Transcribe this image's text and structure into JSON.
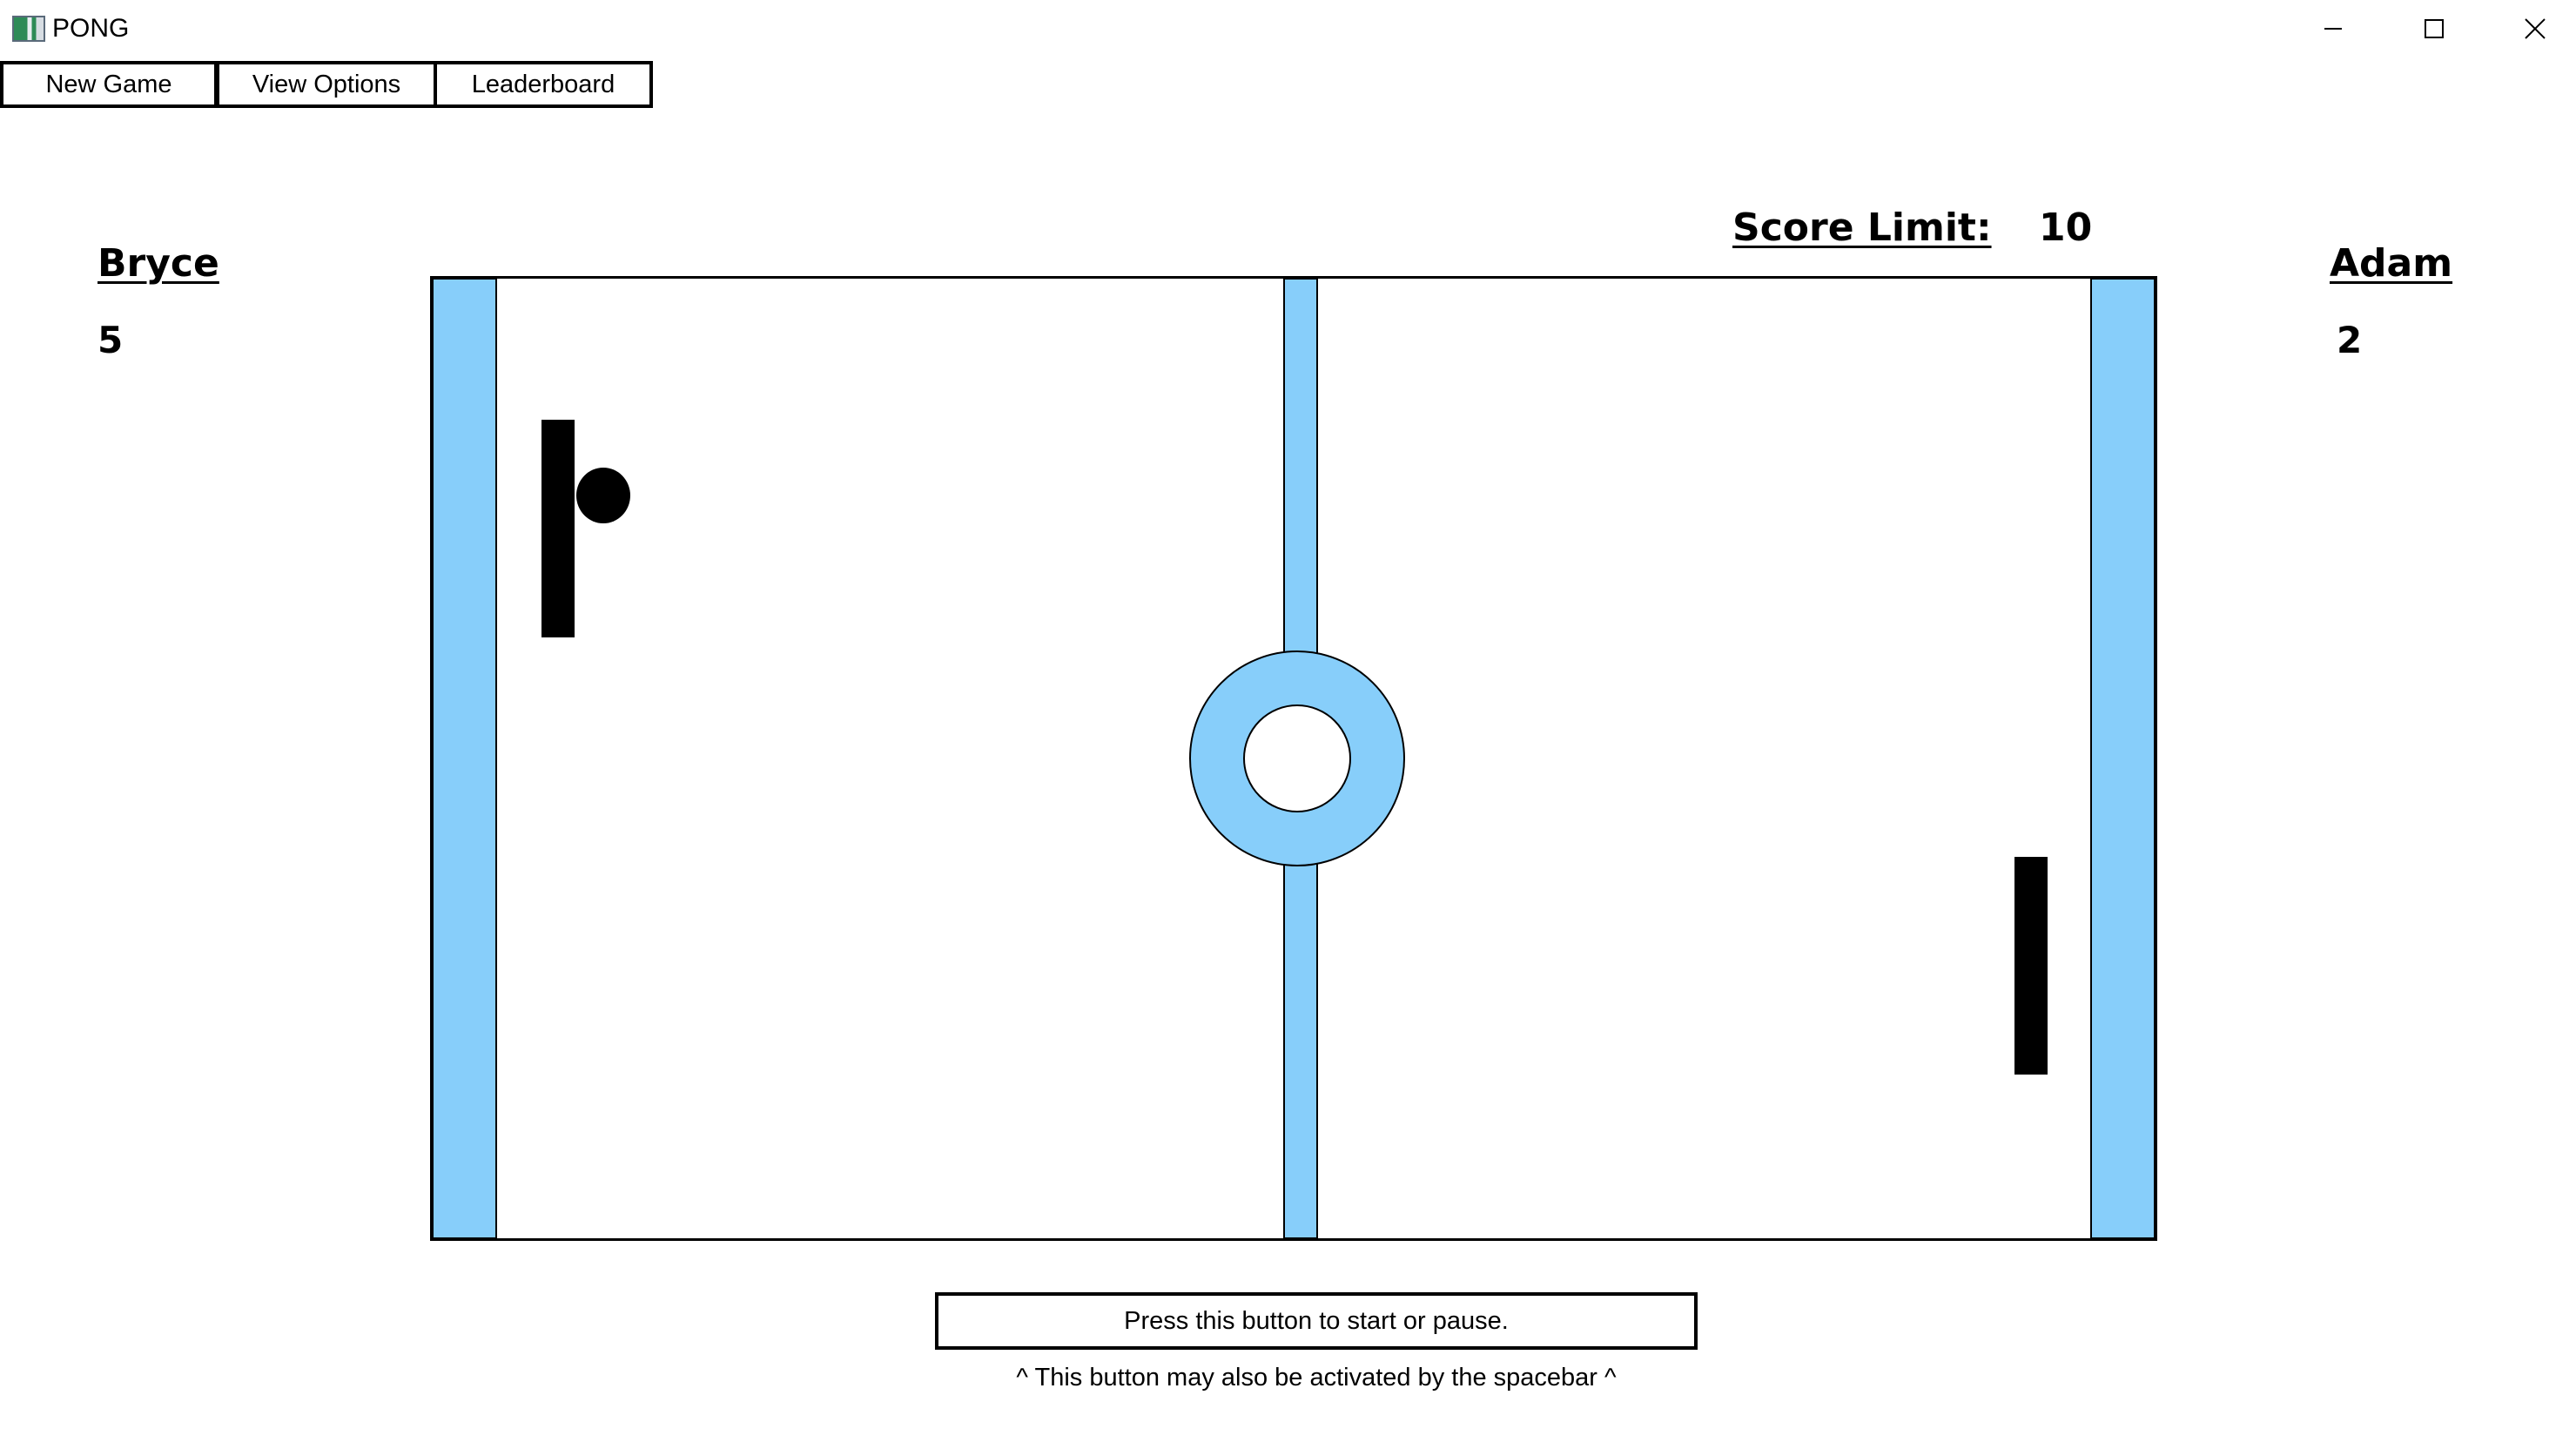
{
  "window": {
    "title": "PONG",
    "icon": "pong-app-icon",
    "controls": {
      "minimize_icon": "minimize-icon",
      "maximize_icon": "maximize-icon",
      "close_icon": "close-icon"
    }
  },
  "menu": {
    "new_game": "New Game",
    "view_options": "View Options",
    "leaderboard": "Leaderboard"
  },
  "players": {
    "left": {
      "name": "Bryce",
      "score": "5"
    },
    "right": {
      "name": "Adam",
      "score": "2"
    }
  },
  "score_limit": {
    "label": "Score Limit:",
    "value": "10"
  },
  "field": {
    "accent_color": "#87CEFA",
    "paddle_color": "#000000",
    "ball_color": "#000000"
  },
  "controls": {
    "start_pause_label": "Press this button to start or pause.",
    "hint": "^ This button may also be activated by the spacebar ^"
  }
}
